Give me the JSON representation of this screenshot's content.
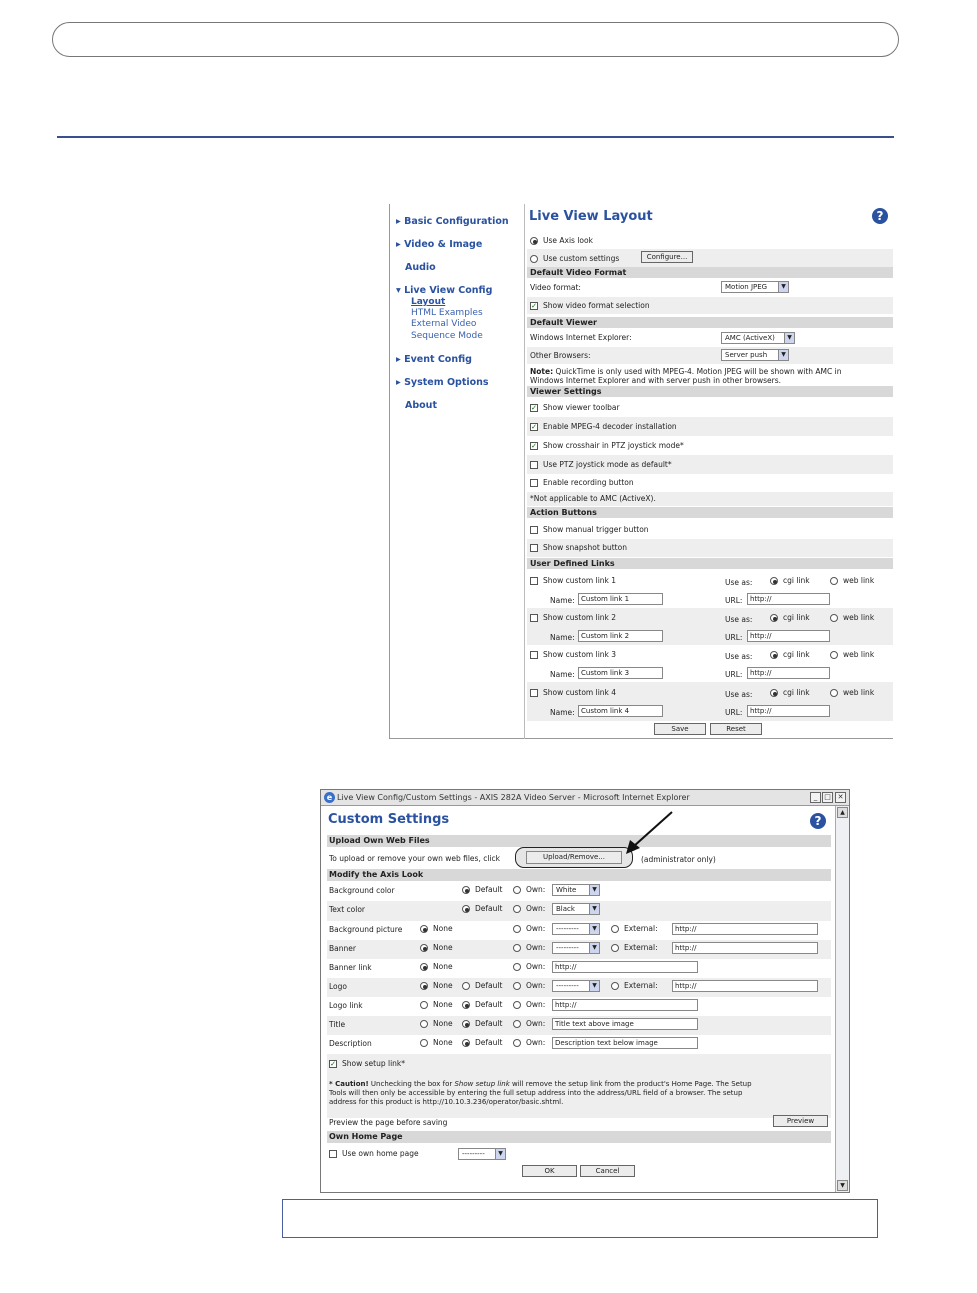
{
  "lv": {
    "nav": {
      "basic": "Basic Configuration",
      "video": "Video & Image",
      "audio": "Audio",
      "live": "Live View Config",
      "sub": [
        "Layout",
        "HTML Examples",
        "External Video",
        "Sequence Mode"
      ],
      "event": "Event Config",
      "system": "System Options",
      "about": "About"
    },
    "title": "Live View Layout",
    "help": "?",
    "use_axis": "Use Axis look",
    "use_custom": "Use custom settings",
    "configure": "Configure...",
    "sec_default_video": "Default Video Format",
    "video_format_label": "Video format:",
    "video_format_value": "Motion JPEG",
    "show_video_format": "Show video format selection",
    "sec_default_viewer": "Default Viewer",
    "wie_label": "Windows Internet Explorer:",
    "wie_value": "AMC (ActiveX)",
    "other_label": "Other Browsers:",
    "other_value": "Server push",
    "note_bold": "Note:",
    "note_line1": " QuickTime is only used with MPEG-4. Motion JPEG will be shown with AMC in",
    "note_line2": "Windows Internet Explorer and with server push in other browsers.",
    "sec_viewer": "Viewer Settings",
    "vs": [
      "Show viewer toolbar",
      "Enable MPEG-4 decoder installation",
      "Show crosshair in PTZ joystick mode*",
      "Use PTZ joystick mode as default*",
      "Enable recording button"
    ],
    "vs_note": "*Not applicable to AMC (ActiveX).",
    "sec_action": "Action Buttons",
    "ab": [
      "Show manual trigger button",
      "Show snapshot button"
    ],
    "sec_links": "User Defined Links",
    "use_as": "Use as:",
    "cgi": "cgi link",
    "web": "web link",
    "name_label": "Name:",
    "url_label": "URL:",
    "links": [
      {
        "label": "Show custom link 1",
        "name": "Custom link 1",
        "url": "http://"
      },
      {
        "label": "Show custom link 2",
        "name": "Custom link 2",
        "url": "http://"
      },
      {
        "label": "Show custom link 3",
        "name": "Custom link 3",
        "url": "http://"
      },
      {
        "label": "Show custom link 4",
        "name": "Custom link 4",
        "url": "http://"
      }
    ],
    "save": "Save",
    "reset": "Reset"
  },
  "cs": {
    "window_title": "Live View Config/Custom Settings - AXIS 282A Video Server - Microsoft Internet Explorer",
    "title": "Custom Settings",
    "help": "?",
    "sec_upload": "Upload Own Web Files",
    "upload_text": "To upload or remove your own web files, click",
    "upload_btn": "Upload/Remove...",
    "admin_only": "(administrator only)",
    "sec_modify": "Modify the Axis Look",
    "opt_none": "None",
    "opt_default": "Default",
    "opt_own": "Own:",
    "opt_external": "External:",
    "rows": {
      "bgcolor": {
        "label": "Background color",
        "own": "White"
      },
      "textcolor": {
        "label": "Text color",
        "own": "Black"
      },
      "bgpic": {
        "label": "Background picture",
        "own": "---------",
        "ext": "http://"
      },
      "banner": {
        "label": "Banner",
        "own": "---------",
        "ext": "http://"
      },
      "bannerlink": {
        "label": "Banner link",
        "own": "http://"
      },
      "logo": {
        "label": "Logo",
        "own": "---------",
        "ext": "http://"
      },
      "logolink": {
        "label": "Logo link",
        "own": "http://"
      },
      "title": {
        "label": "Title",
        "own": "Title text above image"
      },
      "desc": {
        "label": "Description",
        "own": "Description text below image"
      }
    },
    "show_setup": "Show setup link*",
    "caution_bold": "* Caution!",
    "caution_1a": " Unchecking the box for ",
    "caution_1b": "Show setup link",
    "caution_1c": " will remove the setup link from the product's Home Page. The Setup",
    "caution_2": "Tools will then only be accessible by entering the full setup address into the address/URL field of a browser. The setup",
    "caution_3": "address for this product is http://10.10.3.236/operator/basic.shtml.",
    "preview_text": "Preview the page before saving",
    "preview_btn": "Preview",
    "sec_home": "Own Home Page",
    "use_home": "Use own home page",
    "home_select": "---------",
    "ok": "OK",
    "cancel": "Cancel"
  }
}
